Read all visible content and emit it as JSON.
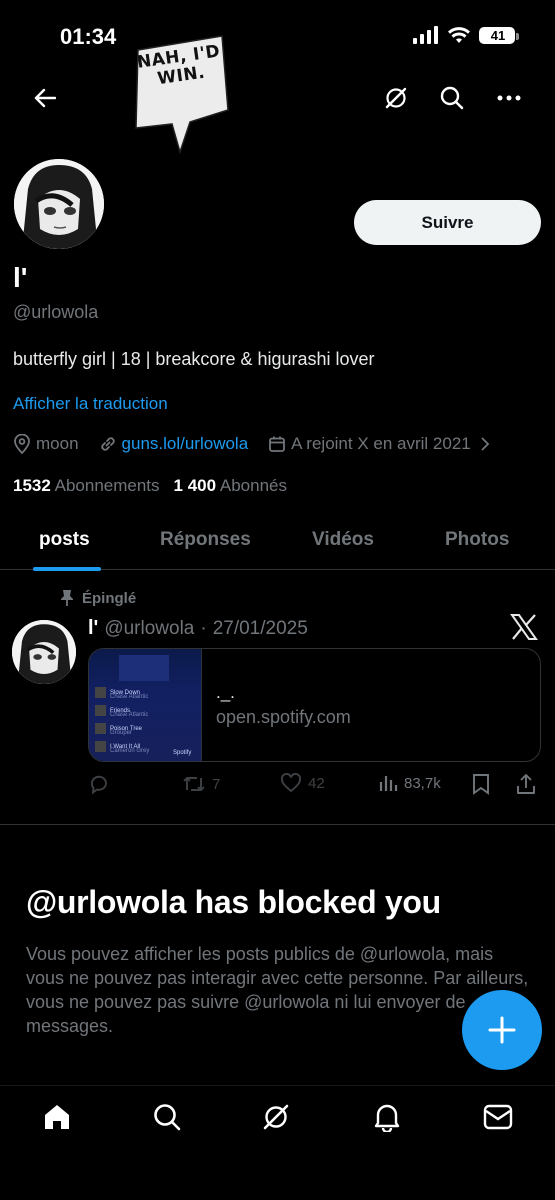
{
  "status_bar": {
    "time": "01:34",
    "battery": "41"
  },
  "sticker": {
    "text": "NAH, I'D WIN."
  },
  "header": {
    "back_icon": "back-arrow-icon",
    "grok_icon": "grok-icon",
    "search_icon": "search-icon",
    "more_icon": "more-icon"
  },
  "profile": {
    "display_name": "l'",
    "handle": "@urlowola",
    "follow_label": "Suivre",
    "bio": "butterfly girl | 18 | breakcore & higurashi lover",
    "translate_label": "Afficher la traduction",
    "location": "moon",
    "website": "guns.lol/urlowola",
    "joined": "A rejoint X en avril 2021",
    "following_count": "1532",
    "following_label": "Abonnements",
    "followers_count": "1 400",
    "followers_label": "Abonnés"
  },
  "tabs": [
    {
      "label": "posts",
      "active": true
    },
    {
      "label": "Réponses",
      "active": false
    },
    {
      "label": "Vidéos",
      "active": false
    },
    {
      "label": "Photos",
      "active": false
    }
  ],
  "post": {
    "pinned_label": "Épinglé",
    "author": "l'",
    "handle": "@urlowola",
    "separator": "·",
    "date": "27/01/2025",
    "card": {
      "title": "._.",
      "domain": "open.spotify.com",
      "tracks": [
        {
          "name": "Slow Down",
          "artist": "Chase Atlantic"
        },
        {
          "name": "Friends",
          "artist": "Chase Atlantic"
        },
        {
          "name": "Poison Tree",
          "artist": "Grouper"
        },
        {
          "name": "I Want It All",
          "artist": "Cameron Grey"
        }
      ],
      "brand": "Spotify"
    },
    "replies": "",
    "reposts": "7",
    "likes": "42",
    "views": "83,7k"
  },
  "blocked": {
    "title": "@urlowola has blocked you",
    "body": "Vous pouvez afficher les posts publics de @urlowola, mais vous ne pouvez pas interagir avec cette personne. Par ailleurs, vous ne pouvez pas suivre @urlowola ni lui envoyer de messages."
  },
  "colors": {
    "accent": "#1d9bf0",
    "background": "#000000",
    "muted": "#71767b"
  }
}
